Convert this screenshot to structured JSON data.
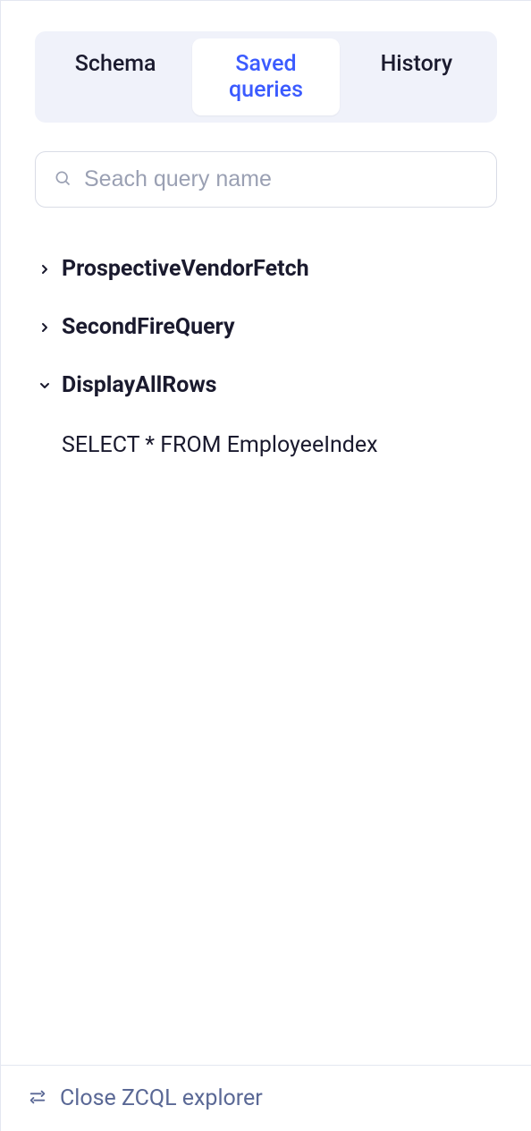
{
  "tabs": {
    "schema": "Schema",
    "saved_queries": "Saved queries",
    "history": "History"
  },
  "search": {
    "placeholder": "Seach query name"
  },
  "queries": [
    {
      "name": "ProspectiveVendorFetch",
      "expanded": false
    },
    {
      "name": "SecondFireQuery",
      "expanded": false
    },
    {
      "name": "DisplayAllRows",
      "expanded": true,
      "body": "SELECT * FROM EmployeeIndex"
    }
  ],
  "footer": {
    "label": "Close ZCQL explorer"
  }
}
